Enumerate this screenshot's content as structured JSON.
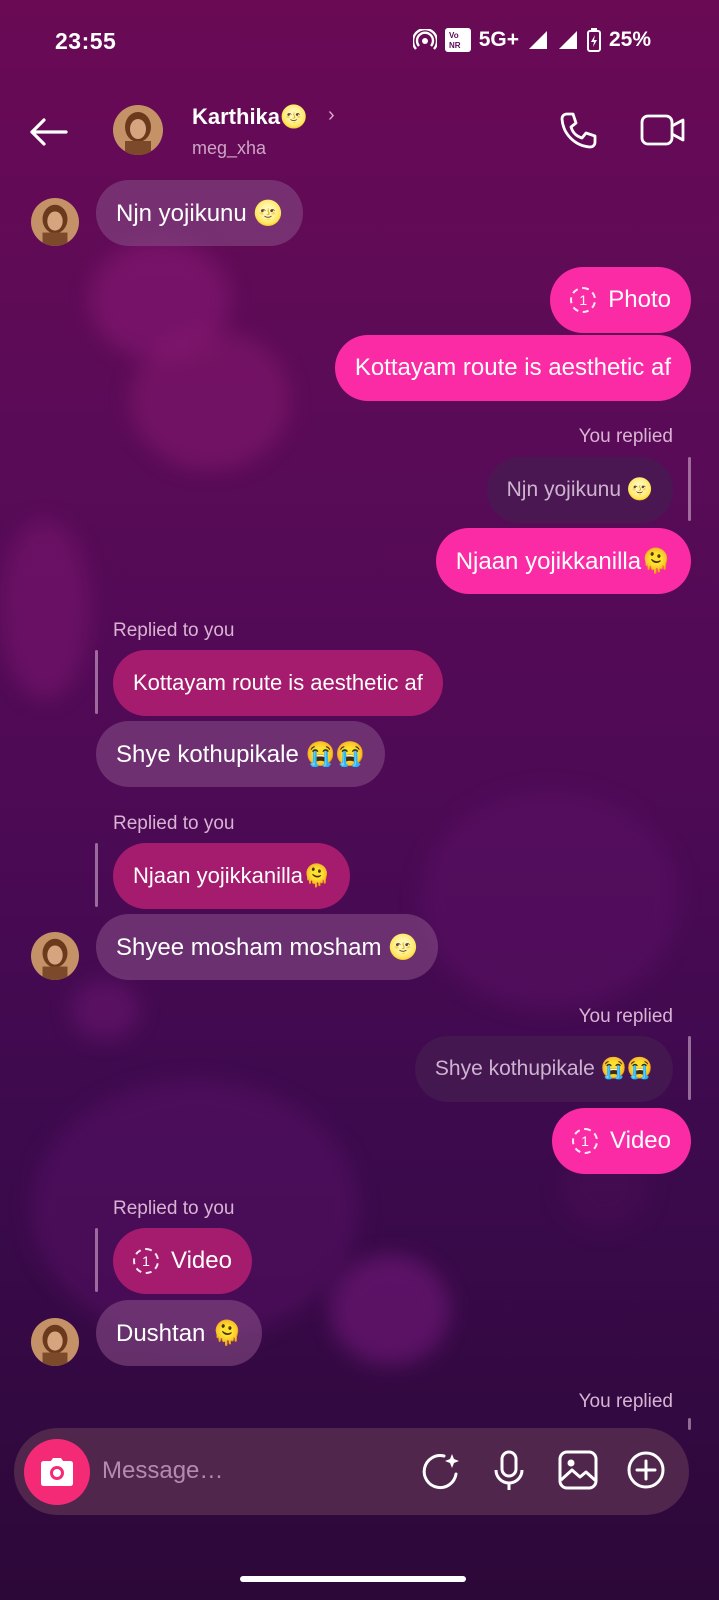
{
  "status_bar": {
    "time": "23:55",
    "network": "5G+",
    "battery": "25%"
  },
  "header": {
    "name": "Karthika🌝",
    "username": "meg_xha",
    "chevron": "›"
  },
  "messages": {
    "m1": "Njn yojikunu 🌝",
    "m2": "Photo",
    "m3": "Kottayam route is aesthetic af",
    "m4_meta": "You replied",
    "m4_quote": "Njn yojikunu 🌝",
    "m4": "Njaan yojikkanilla🫠",
    "m5_meta": "Replied to you",
    "m5_quote": "Kottayam route is aesthetic af",
    "m5": "Shye kothupikale 😭😭",
    "m6_meta": "Replied to you",
    "m6_quote": "Njaan yojikkanilla🫠",
    "m6": "Shyee mosham mosham 🌝",
    "m7_meta": "You replied",
    "m7_quote": "Shye kothupikale 😭😭",
    "m7": "Video",
    "m8_meta": "Replied to you",
    "m8_quote": "Video",
    "m9": "Dushtan 🫠",
    "m10_meta": "You replied",
    "view_once": "1"
  },
  "composer": {
    "placeholder": "Message…"
  },
  "icons": {
    "back": "arrow-left-icon",
    "call": "phone-icon",
    "video_call": "video-camera-icon",
    "camera": "camera-icon",
    "effects": "sparkle-effects-icon",
    "mic": "microphone-icon",
    "gallery": "gallery-icon",
    "more": "plus-circle-icon"
  },
  "colors": {
    "outgoing_bubble": "#fb2ba5",
    "quoted_incoming": "#a51b6d",
    "camera_button": "#f52a77"
  }
}
